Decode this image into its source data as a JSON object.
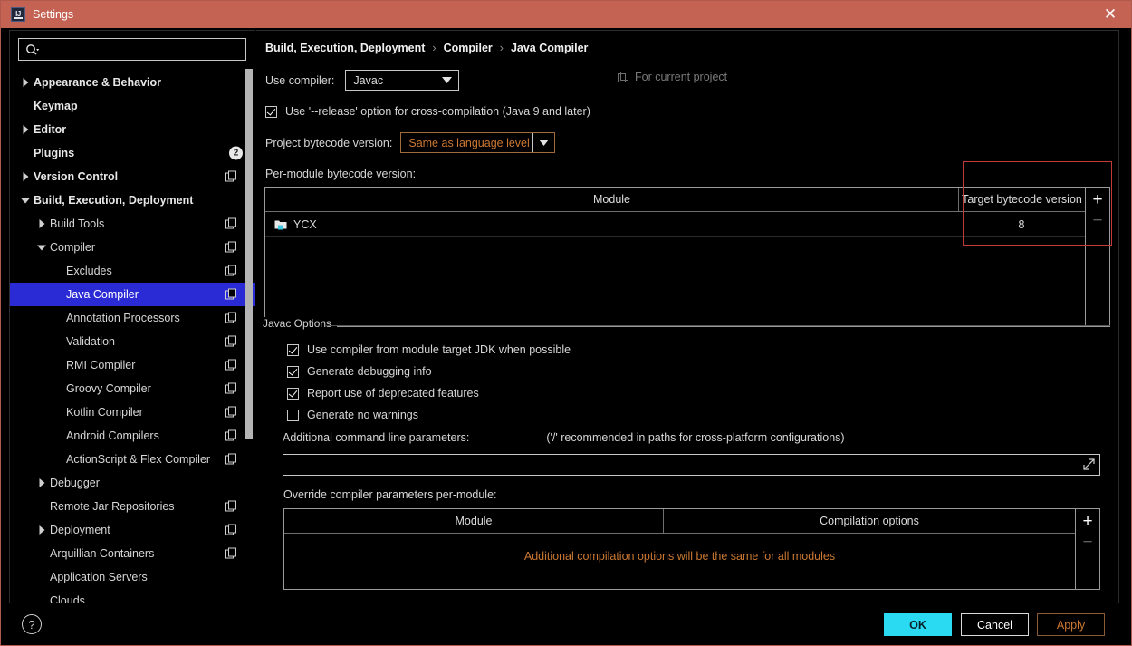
{
  "window": {
    "title": "Settings",
    "app_icon": "intellij-idea-icon",
    "close_icon": "close-icon",
    "titlebar_color": "#c46354"
  },
  "search": {
    "value": "",
    "placeholder": "",
    "icon": "search-icon"
  },
  "sidebar": {
    "scrollbar": "vertical-scrollbar",
    "items": [
      {
        "label": "Appearance & Behavior",
        "arrow": "collapsed",
        "indent": 0,
        "bold": true,
        "copy": false,
        "badge": null,
        "selected": false
      },
      {
        "label": "Keymap",
        "arrow": "none",
        "indent": 0,
        "bold": true,
        "copy": false,
        "badge": null,
        "selected": false
      },
      {
        "label": "Editor",
        "arrow": "collapsed",
        "indent": 0,
        "bold": true,
        "copy": false,
        "badge": null,
        "selected": false
      },
      {
        "label": "Plugins",
        "arrow": "none",
        "indent": 0,
        "bold": true,
        "copy": false,
        "badge": "2",
        "selected": false
      },
      {
        "label": "Version Control",
        "arrow": "collapsed",
        "indent": 0,
        "bold": true,
        "copy": true,
        "badge": null,
        "selected": false
      },
      {
        "label": "Build, Execution, Deployment",
        "arrow": "expanded",
        "indent": 0,
        "bold": true,
        "copy": false,
        "badge": null,
        "selected": false
      },
      {
        "label": "Build Tools",
        "arrow": "collapsed",
        "indent": 1,
        "bold": false,
        "copy": true,
        "badge": null,
        "selected": false
      },
      {
        "label": "Compiler",
        "arrow": "expanded",
        "indent": 1,
        "bold": false,
        "copy": true,
        "badge": null,
        "selected": false
      },
      {
        "label": "Excludes",
        "arrow": "none",
        "indent": 2,
        "bold": false,
        "copy": true,
        "badge": null,
        "selected": false
      },
      {
        "label": "Java Compiler",
        "arrow": "none",
        "indent": 2,
        "bold": false,
        "copy": true,
        "badge": null,
        "selected": true
      },
      {
        "label": "Annotation Processors",
        "arrow": "none",
        "indent": 2,
        "bold": false,
        "copy": true,
        "badge": null,
        "selected": false
      },
      {
        "label": "Validation",
        "arrow": "none",
        "indent": 2,
        "bold": false,
        "copy": true,
        "badge": null,
        "selected": false
      },
      {
        "label": "RMI Compiler",
        "arrow": "none",
        "indent": 2,
        "bold": false,
        "copy": true,
        "badge": null,
        "selected": false
      },
      {
        "label": "Groovy Compiler",
        "arrow": "none",
        "indent": 2,
        "bold": false,
        "copy": true,
        "badge": null,
        "selected": false
      },
      {
        "label": "Kotlin Compiler",
        "arrow": "none",
        "indent": 2,
        "bold": false,
        "copy": true,
        "badge": null,
        "selected": false
      },
      {
        "label": "Android Compilers",
        "arrow": "none",
        "indent": 2,
        "bold": false,
        "copy": true,
        "badge": null,
        "selected": false
      },
      {
        "label": "ActionScript & Flex Compiler",
        "arrow": "none",
        "indent": 2,
        "bold": false,
        "copy": true,
        "badge": null,
        "selected": false
      },
      {
        "label": "Debugger",
        "arrow": "collapsed",
        "indent": 1,
        "bold": false,
        "copy": false,
        "badge": null,
        "selected": false
      },
      {
        "label": "Remote Jar Repositories",
        "arrow": "none",
        "indent": 1,
        "bold": false,
        "copy": true,
        "badge": null,
        "selected": false
      },
      {
        "label": "Deployment",
        "arrow": "collapsed",
        "indent": 1,
        "bold": false,
        "copy": true,
        "badge": null,
        "selected": false
      },
      {
        "label": "Arquillian Containers",
        "arrow": "none",
        "indent": 1,
        "bold": false,
        "copy": true,
        "badge": null,
        "selected": false
      },
      {
        "label": "Application Servers",
        "arrow": "none",
        "indent": 1,
        "bold": false,
        "copy": false,
        "badge": null,
        "selected": false
      },
      {
        "label": "Clouds",
        "arrow": "none",
        "indent": 1,
        "bold": false,
        "copy": false,
        "badge": null,
        "selected": false
      }
    ]
  },
  "main": {
    "breadcrumb": [
      "Build, Execution, Deployment",
      "Compiler",
      "Java Compiler"
    ],
    "breadcrumb_separator": "›",
    "for_current_project": "For current project",
    "for_current_project_icon": "copy-settings-icon",
    "use_compiler_label": "Use compiler:",
    "use_compiler_value": "Javac",
    "release_option_label": "Use '--release' option for cross-compilation (Java 9 and later)",
    "release_option_checked": true,
    "project_bytecode_label": "Project bytecode version:",
    "project_bytecode_value": "Same as language level",
    "per_module_label": "Per-module bytecode version:",
    "bytecode_table": {
      "columns": [
        "Module",
        "Target bytecode version"
      ],
      "rows": [
        {
          "module": "YCX",
          "module_icon": "module-icon",
          "target": "8"
        }
      ],
      "add_button": "+",
      "remove_button": "−"
    },
    "javac_options_legend": "Javac Options",
    "checkboxes": [
      {
        "label": "Use compiler from module target JDK when possible",
        "checked": true
      },
      {
        "label": "Generate debugging info",
        "checked": true
      },
      {
        "label": "Report use of deprecated features",
        "checked": true
      },
      {
        "label": "Generate no warnings",
        "checked": false
      }
    ],
    "additional_params_label": "Additional command line parameters:",
    "additional_params_hint": "('/' recommended in paths for cross-platform configurations)",
    "additional_params_value": "",
    "expand_icon": "expand-editor-icon",
    "override_label": "Override compiler parameters per-module:",
    "override_table": {
      "columns": [
        "Module",
        "Compilation options"
      ],
      "empty_message": "Additional compilation options will be the same for all modules",
      "add_button": "+",
      "remove_button": "−"
    }
  },
  "footer": {
    "help_label": "?",
    "ok_label": "OK",
    "cancel_label": "Cancel",
    "apply_label": "Apply",
    "ok_color": "#2ad9f2",
    "apply_color": "#cc7832"
  },
  "annotation": {
    "color": "#c03a3a",
    "target": "target-bytecode-version-column"
  }
}
